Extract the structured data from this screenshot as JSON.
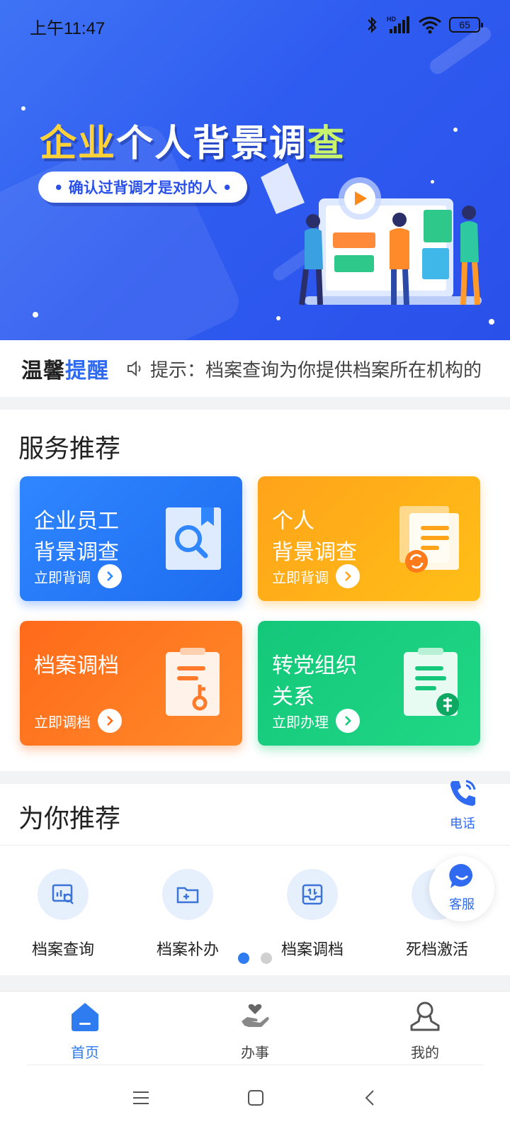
{
  "status_bar": {
    "time": "上午11:47",
    "battery": "65",
    "network": "HD"
  },
  "banner": {
    "title_part1": "企业",
    "title_part2": "个人背景调",
    "title_part3": "查",
    "subtitle": "• 确认过背调才是对的人 •"
  },
  "notice": {
    "brand_part1": "温馨",
    "brand_part2": "提醒",
    "text": "提示：档案查询为你提供档案所在机构的"
  },
  "services": {
    "title": "服务推荐",
    "cards": [
      {
        "line1": "企业员工",
        "line2": "背景调查",
        "cta": "立即背调",
        "color": "#2f86ff"
      },
      {
        "line1": "个人",
        "line2": "背景调查",
        "cta": "立即背调",
        "color": "#ffa31a"
      },
      {
        "line1": "档案调档",
        "line2": "",
        "cta": "立即调档",
        "color": "#ff6a1a"
      },
      {
        "line1": "转党组织",
        "line2": "关系",
        "cta": "立即办理",
        "color": "#14c77a"
      }
    ]
  },
  "recommend": {
    "title": "为你推荐",
    "items": [
      {
        "label": "档案查询",
        "icon": "chart-search-icon"
      },
      {
        "label": "档案补办",
        "icon": "folder-add-icon"
      },
      {
        "label": "档案调档",
        "icon": "archive-transfer-icon"
      },
      {
        "label": "死档激活",
        "icon": "activate-icon"
      }
    ],
    "page_index": 1,
    "page_count": 2
  },
  "float": {
    "phone_label": "电话",
    "cs_label": "客服"
  },
  "tabbar": {
    "tabs": [
      {
        "label": "首页",
        "active": true
      },
      {
        "label": "办事",
        "active": false
      },
      {
        "label": "我的",
        "active": false
      }
    ]
  },
  "colors": {
    "primary": "#2f7bf0",
    "banner": "#2f5cf0"
  }
}
